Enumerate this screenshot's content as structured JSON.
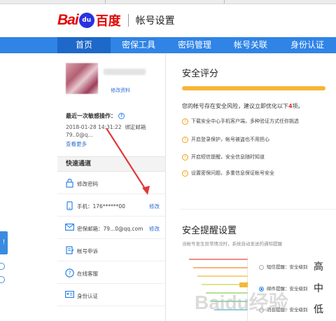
{
  "header": {
    "logo_bai": "Bai",
    "logo_du": "du",
    "logo_cn": "百度",
    "page_title": "帐号设置"
  },
  "nav": {
    "items": [
      "首页",
      "密保工具",
      "密码管理",
      "帐号关联",
      "身份认证"
    ],
    "active_index": 0
  },
  "profile": {
    "edit_link": "修改资料"
  },
  "last_operation": {
    "label": "最近一次敏感操作：",
    "help_icon": "?",
    "datetime": "2018-01-28 14:31:22",
    "action": "绑定邮箱",
    "detail": "79..0@q...",
    "more_link": "查看更多"
  },
  "quick": {
    "title": "快速通道",
    "rows": [
      {
        "label": "修改密码",
        "icon": "lock-icon",
        "action": ""
      },
      {
        "label": "手机：176******00",
        "icon": "phone-icon",
        "action": "修改"
      },
      {
        "label": "密保邮箱：79...0@qq.com",
        "icon": "mail-icon",
        "action": "修改"
      },
      {
        "label": "帐号申诉",
        "icon": "appeal-icon",
        "action": ""
      },
      {
        "label": "在线客服",
        "icon": "help-circle-icon",
        "action": ""
      },
      {
        "label": "身份认证",
        "icon": "id-card-icon",
        "action": ""
      }
    ]
  },
  "security": {
    "title": "安全评分",
    "score_fill": 0.93,
    "risk_before": "您的帐号存在安全风险，建议立即优化以下",
    "risk_count": "4",
    "risk_after": "项。",
    "tips": [
      "下载安全中心手机客户端，多种验证方式任你挑选",
      "开启登录保护，帐号被盗也不用担心",
      "开启短信提醒，安全信息随时知道",
      "设置密保问题，多重信息保证帐号安全"
    ]
  },
  "remind": {
    "title": "安全提醒设置",
    "subtitle": "当帐号发生异常情况时，系统自动发送的通知提醒",
    "levels": [
      {
        "label": "短信提醒：安全级别",
        "word": "高",
        "selected": false
      },
      {
        "label": "邮件提醒：安全级别",
        "word": "中",
        "selected": true
      },
      {
        "label": "消息提醒：安全级别",
        "word": "低",
        "selected": false
      }
    ]
  },
  "watermark": "Baidu经验",
  "left_edge": {
    "badge": "!"
  },
  "colors": {
    "nav": "#2f84e6",
    "nav_active": "#1d68c8",
    "brand_red": "#e10602",
    "score_bar": "#f6b637",
    "link": "#2f6fd0",
    "arrow": "#e0393a"
  }
}
